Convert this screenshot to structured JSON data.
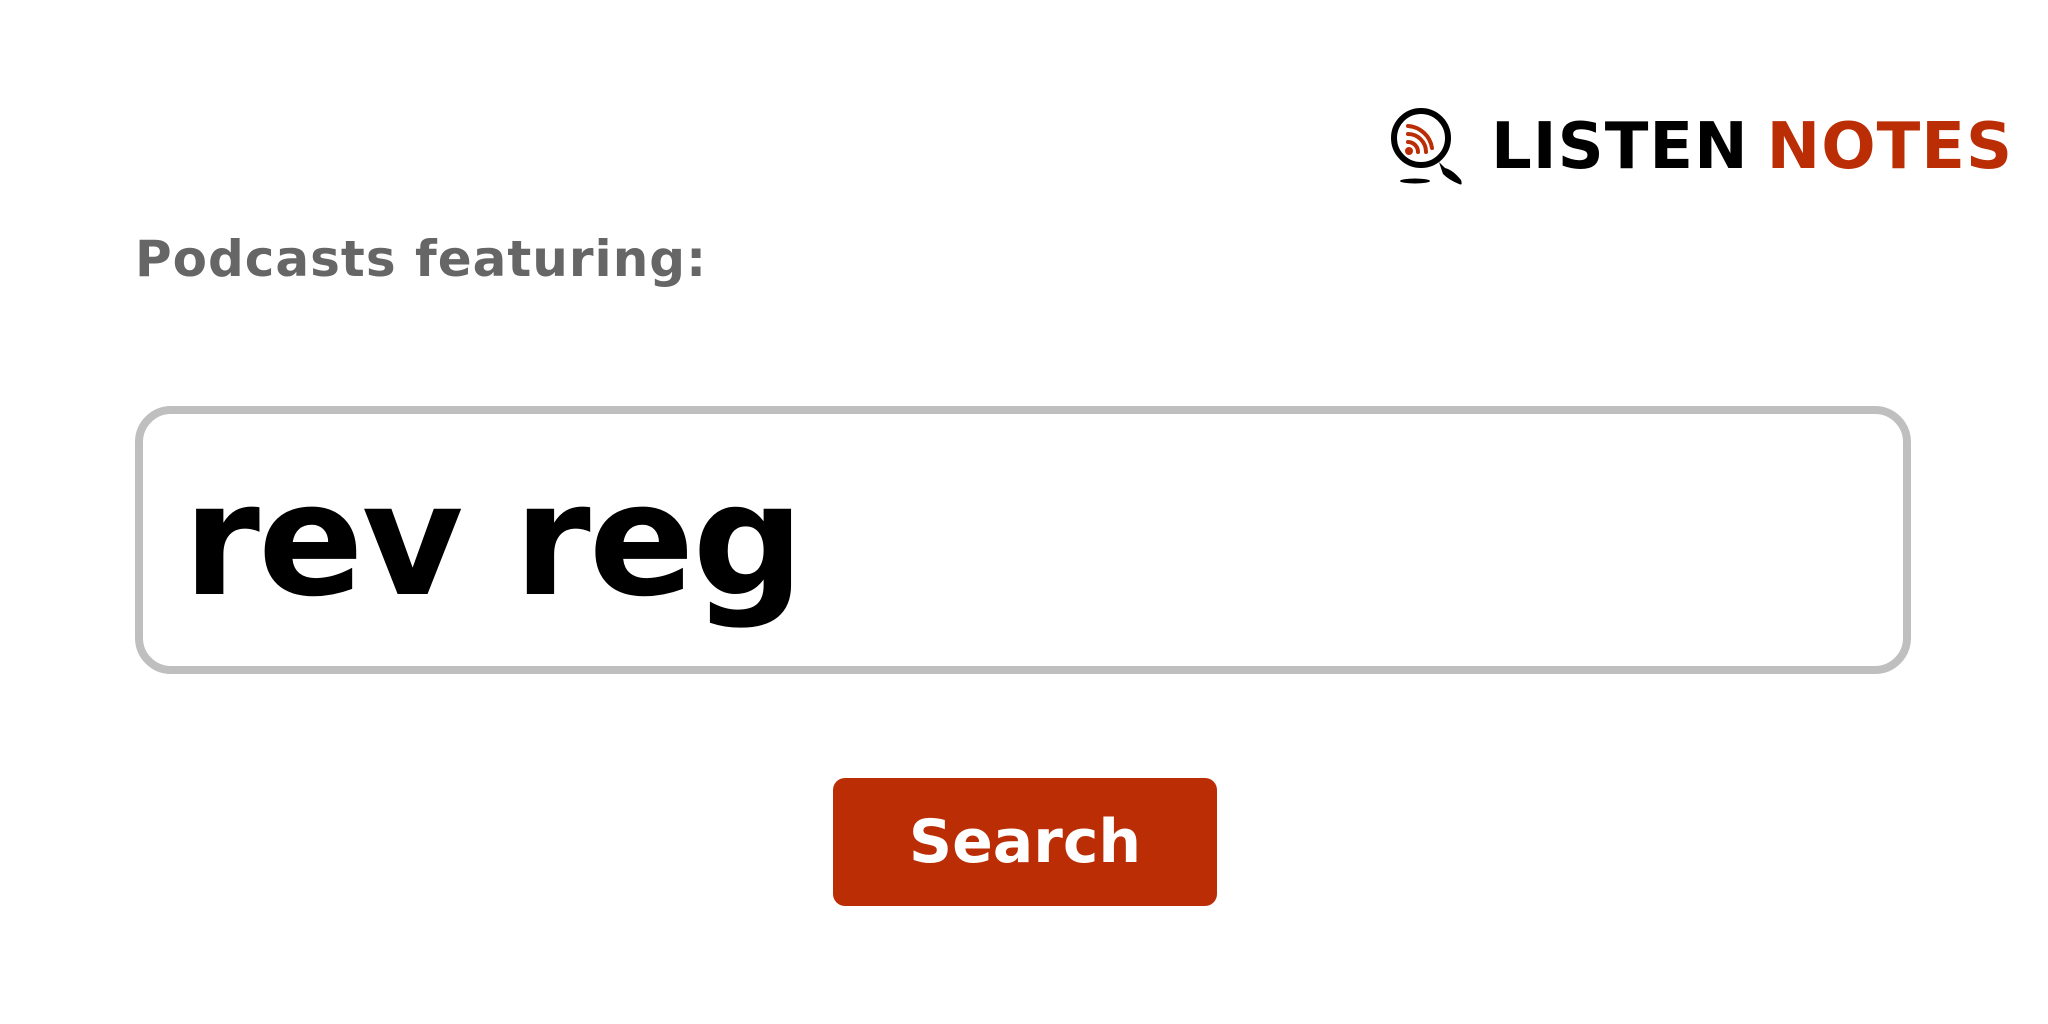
{
  "brand": {
    "word_black": "LISTEN",
    "word_accent": "NOTES",
    "icon": "podcast-search-magnifier-icon",
    "accent_color": "#bb2d05"
  },
  "label": "Podcasts featuring:",
  "search": {
    "value": "rev reg"
  },
  "button": {
    "label": "Search"
  },
  "colors": {
    "label_text": "#666666",
    "input_border": "#bfbfbf",
    "button_bg": "#bb2d05",
    "button_text": "#ffffff"
  }
}
